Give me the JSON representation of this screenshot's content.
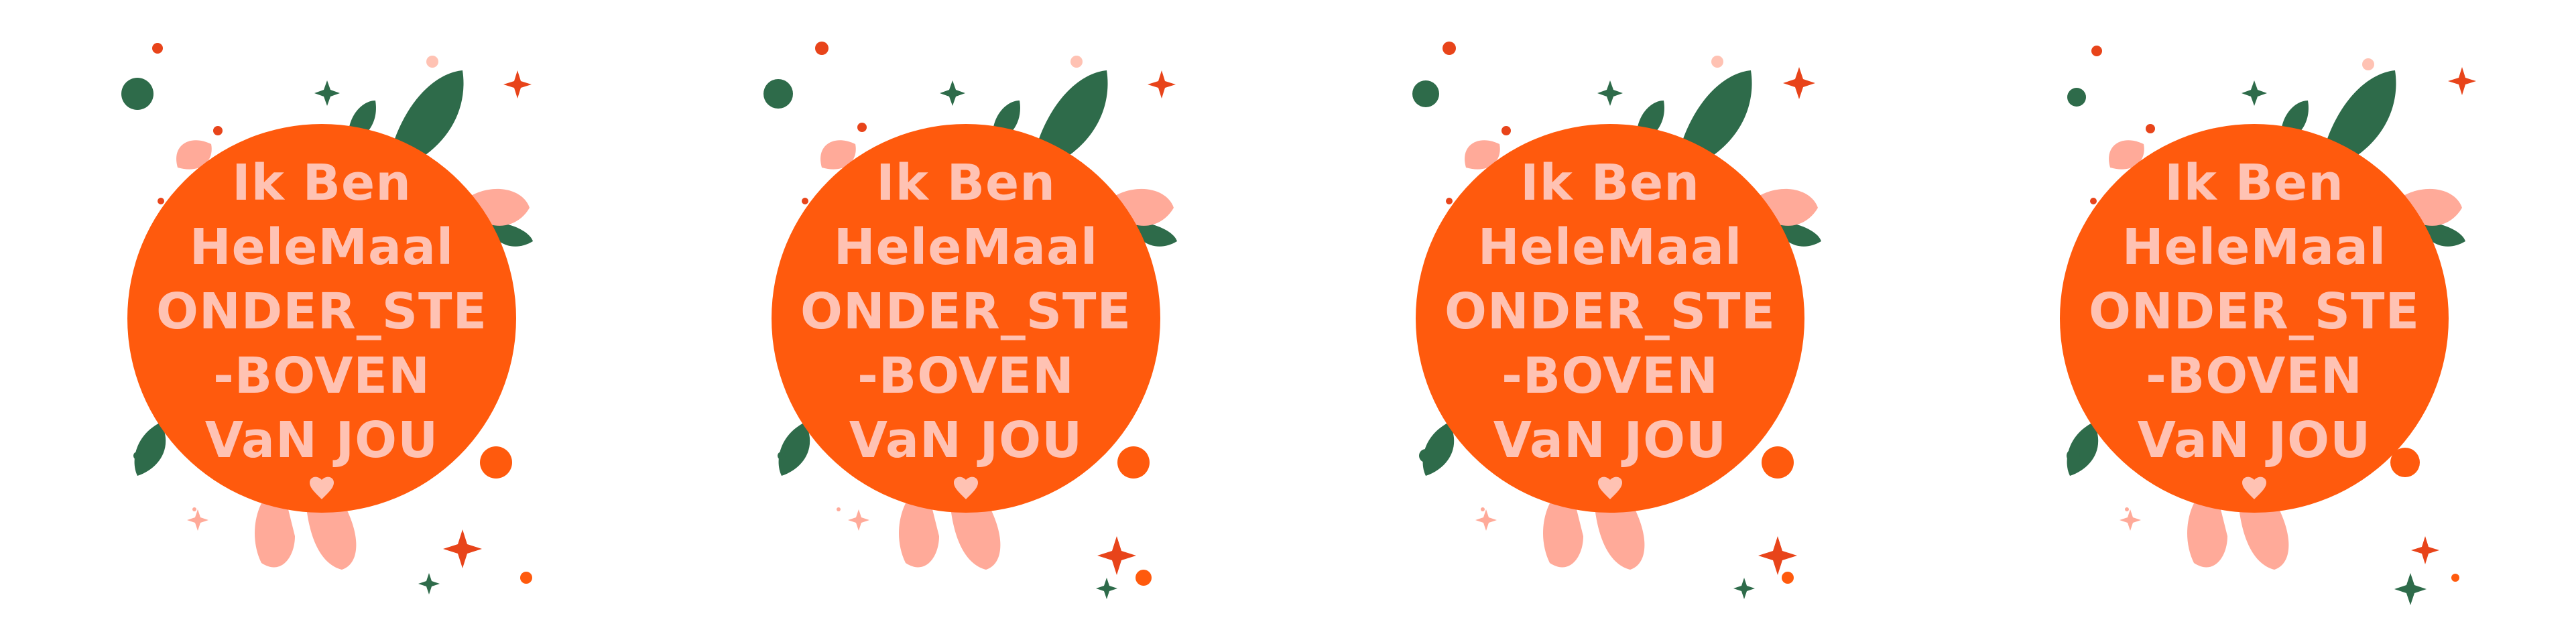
{
  "cards": [
    {
      "lines": [
        "Ik Ben",
        "HeleMaal",
        "ONDER_STE",
        "-BOVEN",
        "VaN JOU"
      ]
    },
    {
      "lines": [
        "Ik Ben",
        "HeleMaal",
        "ONDER_STE",
        "-BOVEN",
        "VaN JOU"
      ]
    },
    {
      "lines": [
        "Ik Ben",
        "HeleMaal",
        "ONDER_STE",
        "-BOVEN",
        "VaN JOU"
      ]
    },
    {
      "lines": [
        "Ik Ben",
        "HeleMaal",
        "ONDER_STE",
        "-BOVEN",
        "VaN JOU"
      ]
    }
  ],
  "colors": {
    "circle": "#ff5a0d",
    "text": "#ffc2b3",
    "leaf": "#2e6b4a",
    "blush": "#ffaa99",
    "accent": "#e8441a"
  },
  "icons": [
    "heart-icon",
    "sparkle-icon",
    "leaf-icon",
    "dot-icon"
  ]
}
